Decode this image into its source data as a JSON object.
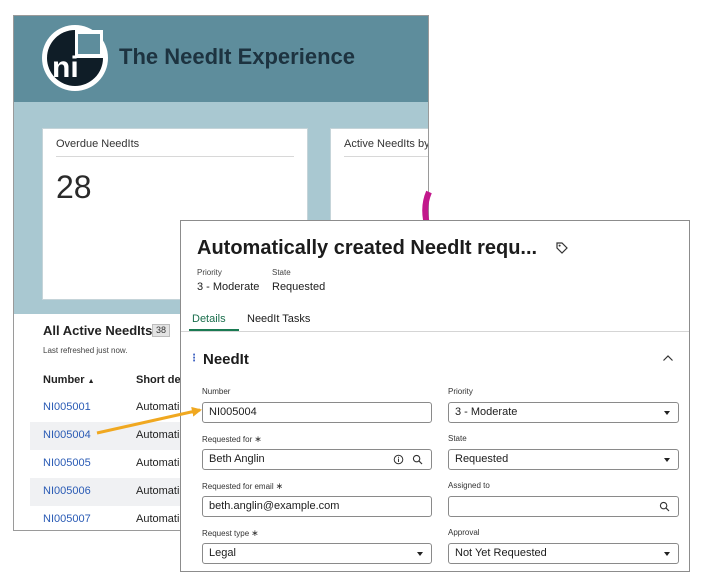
{
  "dashboard": {
    "logo_text": "ni",
    "title": "The NeedIt Experience",
    "cards": [
      {
        "title": "Overdue NeedIts",
        "value": "28"
      },
      {
        "title": "Active NeedIts by"
      }
    ],
    "list": {
      "title": "All Active NeedIts",
      "count": "38",
      "refreshed": "Last refreshed just now.",
      "columns": [
        "Number",
        "Short des"
      ],
      "sort_indicator": "▲",
      "rows": [
        {
          "number": "NI005001",
          "short": "Automati"
        },
        {
          "number": "NI005004",
          "short": "Automati"
        },
        {
          "number": "NI005005",
          "short": "Automati"
        },
        {
          "number": "NI005006",
          "short": "Automati"
        },
        {
          "number": "NI005007",
          "short": "Automati"
        }
      ]
    }
  },
  "form": {
    "title": "Automatically created NeedIt requ...",
    "meta": {
      "priority_label": "Priority",
      "priority_value": "3 - Moderate",
      "state_label": "State",
      "state_value": "Requested"
    },
    "tabs": [
      "Details",
      "NeedIt Tasks"
    ],
    "active_tab": "Details",
    "section_title": "NeedIt",
    "fields": {
      "number": {
        "label": "Number",
        "value": "NI005004"
      },
      "priority": {
        "label": "Priority",
        "value": "3 - Moderate"
      },
      "requested_for": {
        "label": "Requested for",
        "value": "Beth Anglin"
      },
      "state": {
        "label": "State",
        "value": "Requested"
      },
      "requested_for_email": {
        "label": "Requested for email",
        "value": "beth.anglin@example.com"
      },
      "assigned_to": {
        "label": "Assigned to",
        "value": ""
      },
      "request_type": {
        "label": "Request type",
        "value": "Legal"
      },
      "approval": {
        "label": "Approval",
        "value": "Not Yet Requested"
      }
    },
    "required_mark": "∗"
  },
  "colors": {
    "header": "#5e8d9c",
    "band": "#a9c8d1",
    "link": "#2a5bb5",
    "arrow": "#f0a820",
    "tab_active": "#1a7a52"
  },
  "icons": [
    "logo-icon",
    "tag-icon",
    "chevron-up-icon",
    "info-icon",
    "search-icon",
    "chevron-down-icon",
    "drag-handle-icon",
    "sort-asc-icon"
  ]
}
